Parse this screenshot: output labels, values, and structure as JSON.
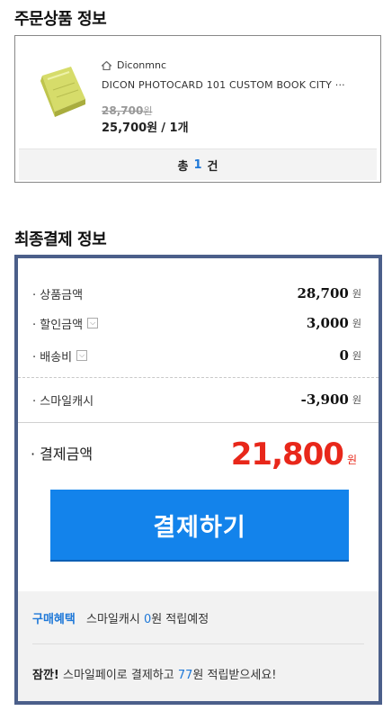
{
  "order_section": {
    "title": "주문상품 정보",
    "seller": "Diconmnc",
    "product_name": "DICON PHOTOCARD 101 CUSTOM BOOK CITY ···",
    "original_price": "28,700",
    "original_price_unit": "원",
    "sale_price": "25,700원",
    "quantity_text": "/ 1개",
    "total_prefix": "총",
    "total_count": "1",
    "total_suffix": "건"
  },
  "payment_section": {
    "title": "최종결제 정보",
    "rows": [
      {
        "label": "· 상품금액",
        "value": "28,700",
        "unit": "원"
      },
      {
        "label": "· 할인금액",
        "value": "3,000",
        "unit": "원"
      },
      {
        "label": "· 배송비",
        "value": "0",
        "unit": "원"
      },
      {
        "label": "· 스마일캐시",
        "value": "-3,900",
        "unit": "원"
      }
    ],
    "final_label": "· 결제금액",
    "final_amount": "21,800",
    "final_unit": "원",
    "pay_button": "결제하기"
  },
  "benefit": {
    "tag": "구매혜택",
    "cash_prefix": "스마일캐시",
    "cash_amount": "0",
    "cash_suffix": "원 적립예정",
    "tip_bold": "잠깐!",
    "tip_prefix": "스마일페이로 결제하고",
    "tip_amount": "77",
    "tip_suffix": "원 적립받으세요!"
  },
  "colors": {
    "accent_blue": "#1383eb",
    "price_red": "#e8271a",
    "box_border": "#4b5f8a"
  }
}
